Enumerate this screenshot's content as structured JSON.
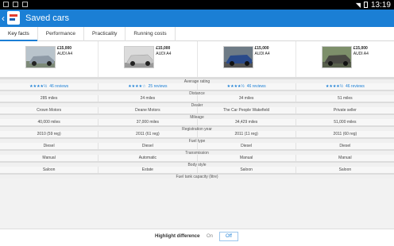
{
  "status_bar": {
    "time": "13:19"
  },
  "header": {
    "back_glyph": "‹",
    "title": "Saved cars"
  },
  "tabs": [
    {
      "label": "Key facts"
    },
    {
      "label": "Performance"
    },
    {
      "label": "Practicality"
    },
    {
      "label": "Running costs"
    }
  ],
  "cars": [
    {
      "price": "£15,000",
      "model": "AUDI A4",
      "thumb_color": "#8e9aa6"
    },
    {
      "price": "£15,000",
      "model": "AUDI A4",
      "thumb_color": "#c8c8c8"
    },
    {
      "price": "£15,000",
      "model": "AUDI A4",
      "thumb_color": "#2a4a8a"
    },
    {
      "price": "£15,000",
      "model": "AUDI A4",
      "thumb_color": "#4a4a44"
    }
  ],
  "rows": {
    "average_rating": {
      "label": "Average rating",
      "values": [
        {
          "stars": "★★★★½",
          "reviews": "46 reviews"
        },
        {
          "stars": "★★★★☆",
          "reviews": "25 reviews"
        },
        {
          "stars": "★★★★½",
          "reviews": "46 reviews"
        },
        {
          "stars": "★★★★½",
          "reviews": "46 reviews"
        }
      ]
    },
    "distance": {
      "label": "Distance",
      "values": [
        "285 miles",
        "24 miles",
        "34 miles",
        "51 miles"
      ]
    },
    "dealer": {
      "label": "Dealer",
      "values": [
        "Crown Motors",
        "Deane Motors",
        "The Car People Wakefield",
        "Private seller"
      ]
    },
    "mileage": {
      "label": "Mileage",
      "values": [
        "40,000 miles",
        "37,000 miles",
        "34,429 miles",
        "51,000 miles"
      ]
    },
    "registration_year": {
      "label": "Registration year",
      "values": [
        "2010 (59 reg)",
        "2011 (61 reg)",
        "2011 (11 reg)",
        "2011 (60 reg)"
      ]
    },
    "fuel_type": {
      "label": "Fuel type",
      "values": [
        "Diesel",
        "Diesel",
        "Diesel",
        "Diesel"
      ]
    },
    "transmission": {
      "label": "Transmission",
      "values": [
        "Manual",
        "Automatic",
        "Manual",
        "Manual"
      ]
    },
    "body_style": {
      "label": "Body style",
      "values": [
        "Saloon",
        "Estate",
        "Saloon",
        "Saloon"
      ]
    },
    "fuel_tank": {
      "label": "Fuel tank capacity (litre)"
    }
  },
  "footer": {
    "highlight_label": "Highlight differences",
    "on_label": "On",
    "off_label": "Off"
  },
  "colors": {
    "accent": "#1b7fd5",
    "brand_red": "#e53e2e"
  }
}
